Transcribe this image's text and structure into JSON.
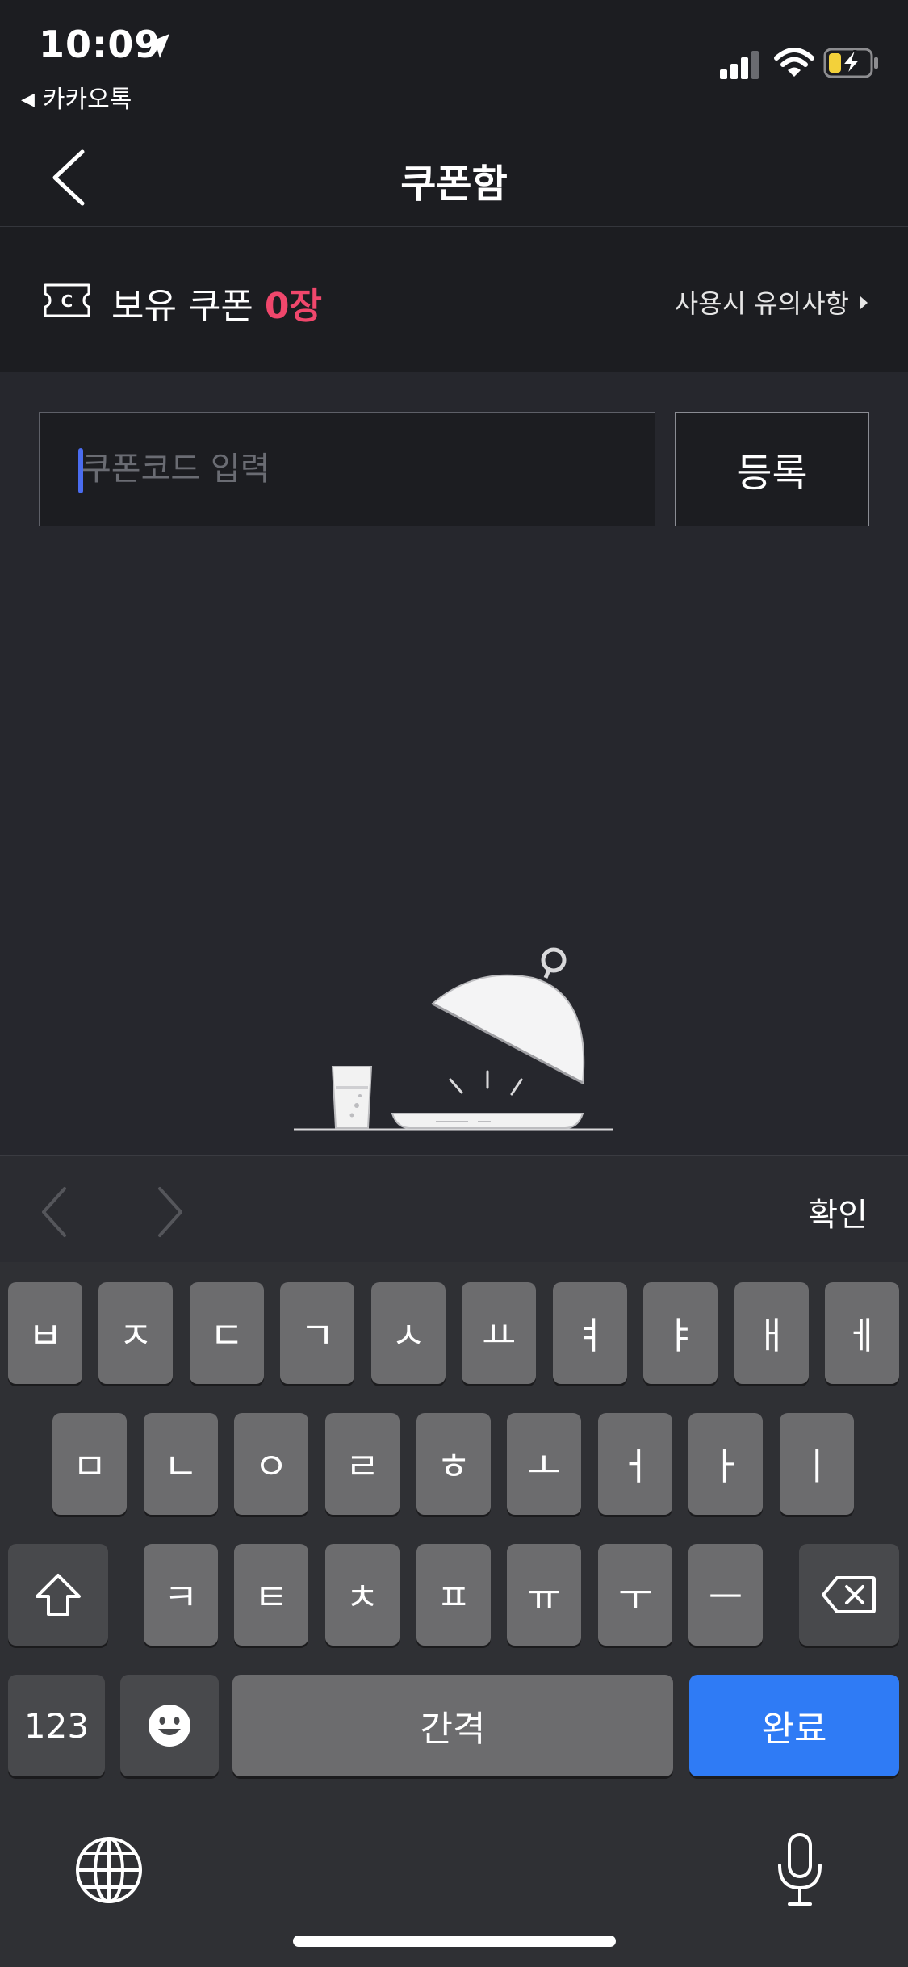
{
  "status_bar": {
    "time": "10:09",
    "back_app": "카카오톡"
  },
  "nav": {
    "title": "쿠폰함"
  },
  "summary": {
    "label": "보유 쿠폰 ",
    "count": "0장",
    "notice_link": "사용시 유의사항"
  },
  "coupon_form": {
    "placeholder": "쿠폰코드 입력",
    "value": "",
    "register_label": "등록"
  },
  "accessory_bar": {
    "confirm_label": "확인"
  },
  "keyboard": {
    "row1": [
      "ㅂ",
      "ㅈ",
      "ㄷ",
      "ㄱ",
      "ㅅ",
      "ㅛ",
      "ㅕ",
      "ㅑ",
      "ㅐ",
      "ㅔ"
    ],
    "row2": [
      "ㅁ",
      "ㄴ",
      "ㅇ",
      "ㄹ",
      "ㅎ",
      "ㅗ",
      "ㅓ",
      "ㅏ",
      "ㅣ"
    ],
    "row3": [
      "ㅋ",
      "ㅌ",
      "ㅊ",
      "ㅍ",
      "ㅠ",
      "ㅜ",
      "ㅡ"
    ],
    "num_label": "123",
    "space_label": "간격",
    "done_label": "완료"
  },
  "colors": {
    "accent_count": "#f0476c",
    "cursor": "#4a6cf0",
    "done_key": "#2f7bf5"
  }
}
